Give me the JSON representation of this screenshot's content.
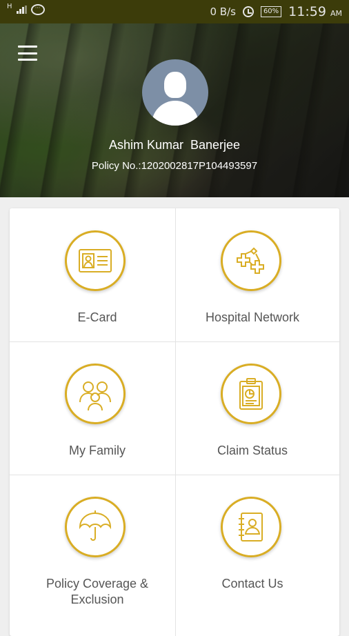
{
  "status_bar": {
    "network_type": "H",
    "speed": "0 B/s",
    "battery": "60%",
    "time": "11:59",
    "ampm": "AM"
  },
  "profile": {
    "name": "Ashim Kumar  Banerjee",
    "policy": "Policy No.:1202002817P104493597"
  },
  "menu": [
    {
      "label": "E-Card",
      "icon": "id-card-icon"
    },
    {
      "label": "Hospital Network",
      "icon": "medical-network-icon"
    },
    {
      "label": "My Family",
      "icon": "family-icon"
    },
    {
      "label": "Claim Status",
      "icon": "clipboard-chart-icon"
    },
    {
      "label": "Policy Coverage &\nExclusion",
      "icon": "umbrella-icon"
    },
    {
      "label": "Contact Us",
      "icon": "contact-book-icon"
    }
  ],
  "colors": {
    "accent_gold": "#d9ad24",
    "status_bar": "#3c3c0a"
  }
}
